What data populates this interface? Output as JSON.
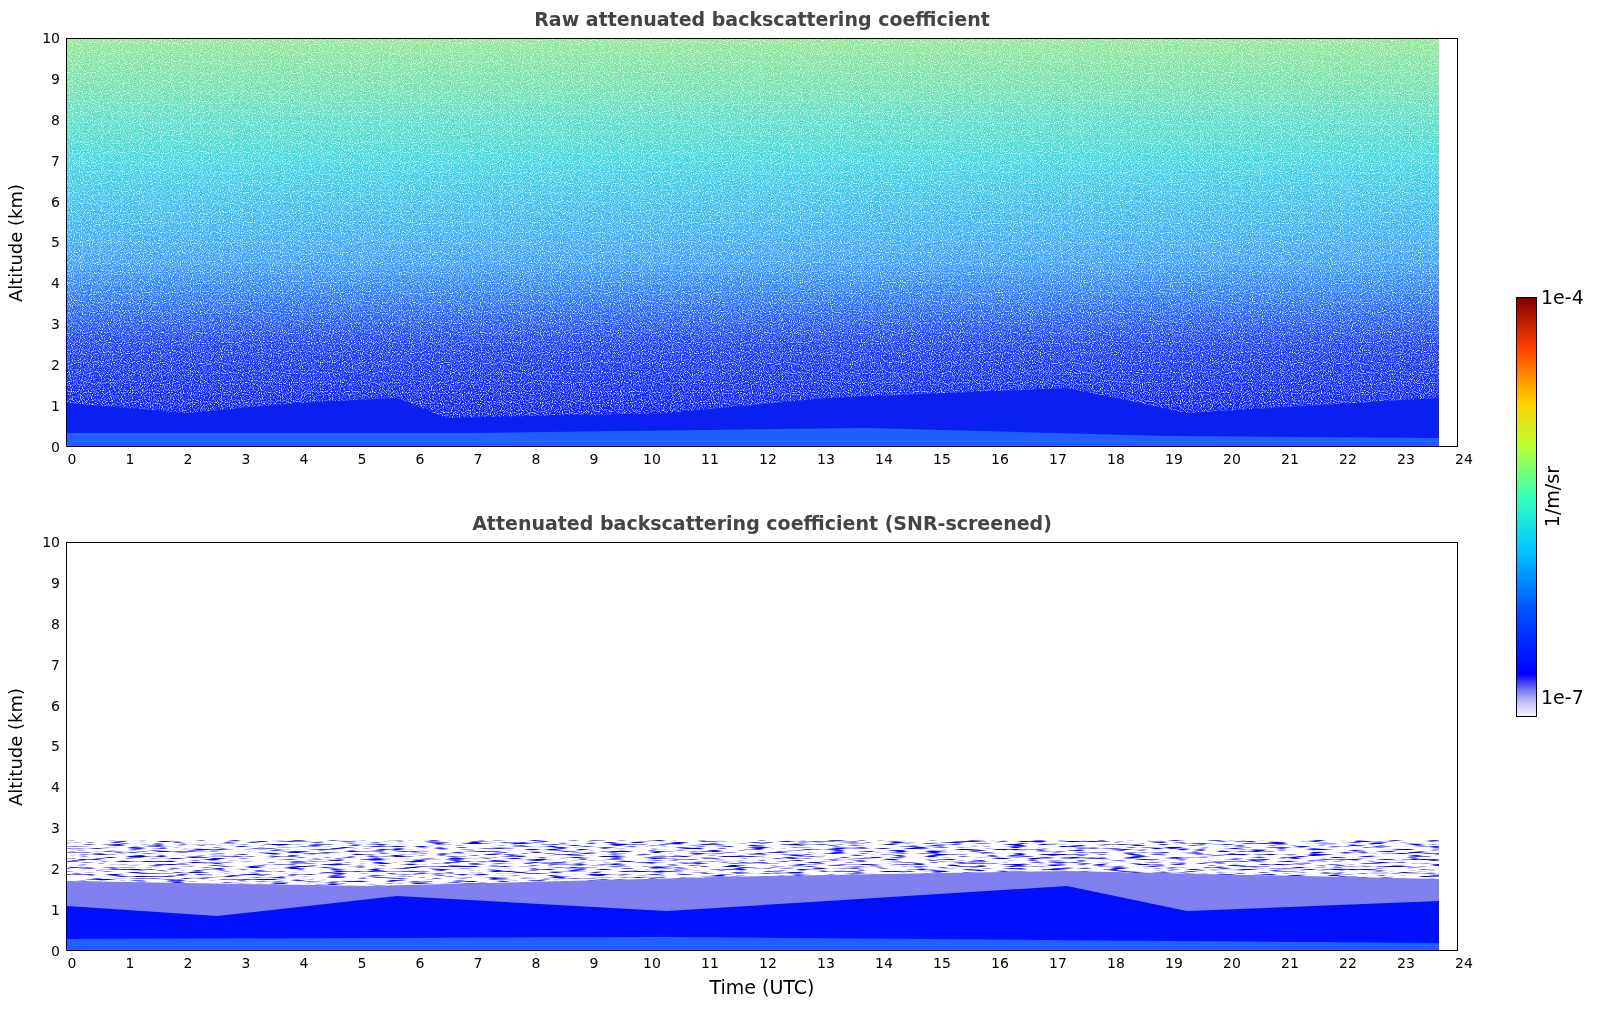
{
  "panels": [
    {
      "kind": "raw",
      "title": "Raw attenuated backscattering coefficient",
      "ylabel": "Altitude (km)",
      "yticks": [
        "10",
        "9",
        "8",
        "7",
        "6",
        "5",
        "4",
        "3",
        "2",
        "1",
        "0"
      ],
      "xticks": [
        "0",
        "1",
        "2",
        "3",
        "4",
        "5",
        "6",
        "7",
        "8",
        "9",
        "10",
        "11",
        "12",
        "13",
        "14",
        "15",
        "16",
        "17",
        "18",
        "19",
        "20",
        "21",
        "22",
        "23",
        "24"
      ]
    },
    {
      "kind": "screened",
      "title": "Attenuated backscattering coefficient (SNR-screened)",
      "ylabel": "Altitude (km)",
      "yticks": [
        "10",
        "9",
        "8",
        "7",
        "6",
        "5",
        "4",
        "3",
        "2",
        "1",
        "0"
      ],
      "xticks": [
        "0",
        "1",
        "2",
        "3",
        "4",
        "5",
        "6",
        "7",
        "8",
        "9",
        "10",
        "11",
        "12",
        "13",
        "14",
        "15",
        "16",
        "17",
        "18",
        "19",
        "20",
        "21",
        "22",
        "23",
        "24"
      ],
      "xlabel": "Time (UTC)"
    }
  ],
  "colorbar": {
    "max": "1e-4",
    "min": "1e-7",
    "label": "1/m/sr"
  }
}
